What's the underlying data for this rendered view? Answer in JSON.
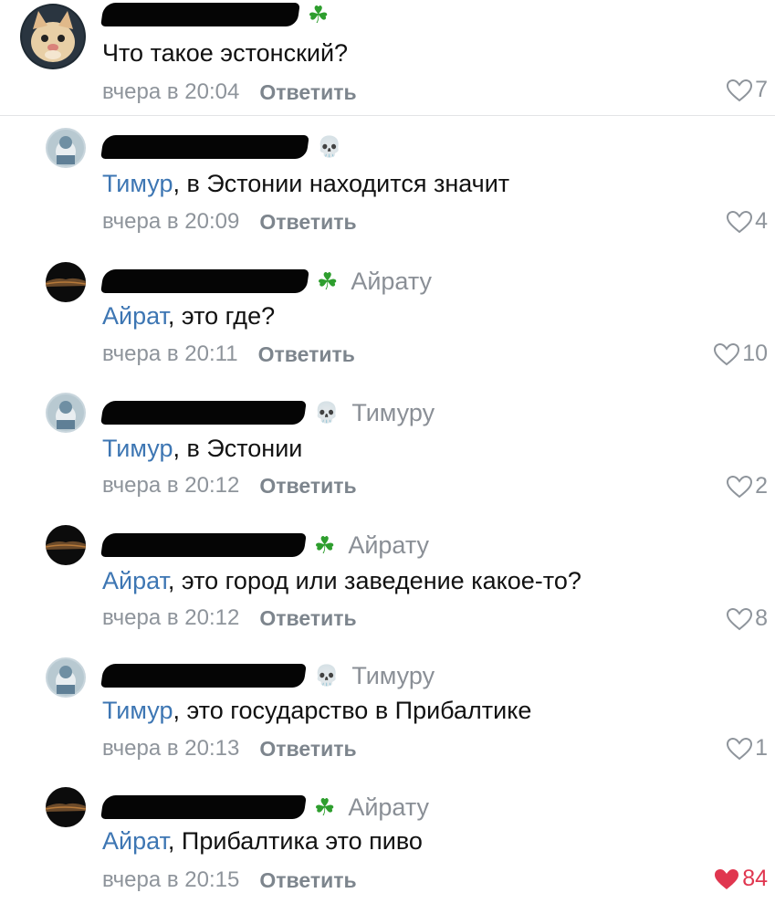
{
  "comments": [
    {
      "author_icon": "clover",
      "reply_to": "",
      "mention": "",
      "text": "Что такое эстонский?",
      "time": "вчера в 20:04",
      "reply_label": "Ответить",
      "likes": "7",
      "liked": false
    },
    {
      "author_icon": "skull",
      "reply_to": "",
      "mention": "Тимур",
      "text": ", в Эстонии находится значит",
      "time": "вчера в 20:09",
      "reply_label": "Ответить",
      "likes": "4",
      "liked": false
    },
    {
      "author_icon": "clover",
      "reply_to": "Айрату",
      "mention": "Айрат",
      "text": ", это где?",
      "time": "вчера в 20:11",
      "reply_label": "Ответить",
      "likes": "10",
      "liked": false
    },
    {
      "author_icon": "skull",
      "reply_to": "Тимуру",
      "mention": "Тимур",
      "text": ", в Эстонии",
      "time": "вчера в 20:12",
      "reply_label": "Ответить",
      "likes": "2",
      "liked": false
    },
    {
      "author_icon": "clover",
      "reply_to": "Айрату",
      "mention": "Айрат",
      "text": ", это город или заведение какое-то?",
      "time": "вчера в 20:12",
      "reply_label": "Ответить",
      "likes": "8",
      "liked": false
    },
    {
      "author_icon": "skull",
      "reply_to": "Тимуру",
      "mention": "Тимур",
      "text": ", это государство в Прибалтике",
      "time": "вчера в 20:13",
      "reply_label": "Ответить",
      "likes": "1",
      "liked": false
    },
    {
      "author_icon": "clover",
      "reply_to": "Айрату",
      "mention": "Айрат",
      "text": ", Прибалтика это пиво",
      "time": "вчера в 20:15",
      "reply_label": "Ответить",
      "likes": "84",
      "liked": true
    }
  ],
  "colors": {
    "mention": "#3d76b3",
    "meta": "#8e949b",
    "liked_heart": "#e0364f",
    "clover": "#2e9e2e"
  }
}
